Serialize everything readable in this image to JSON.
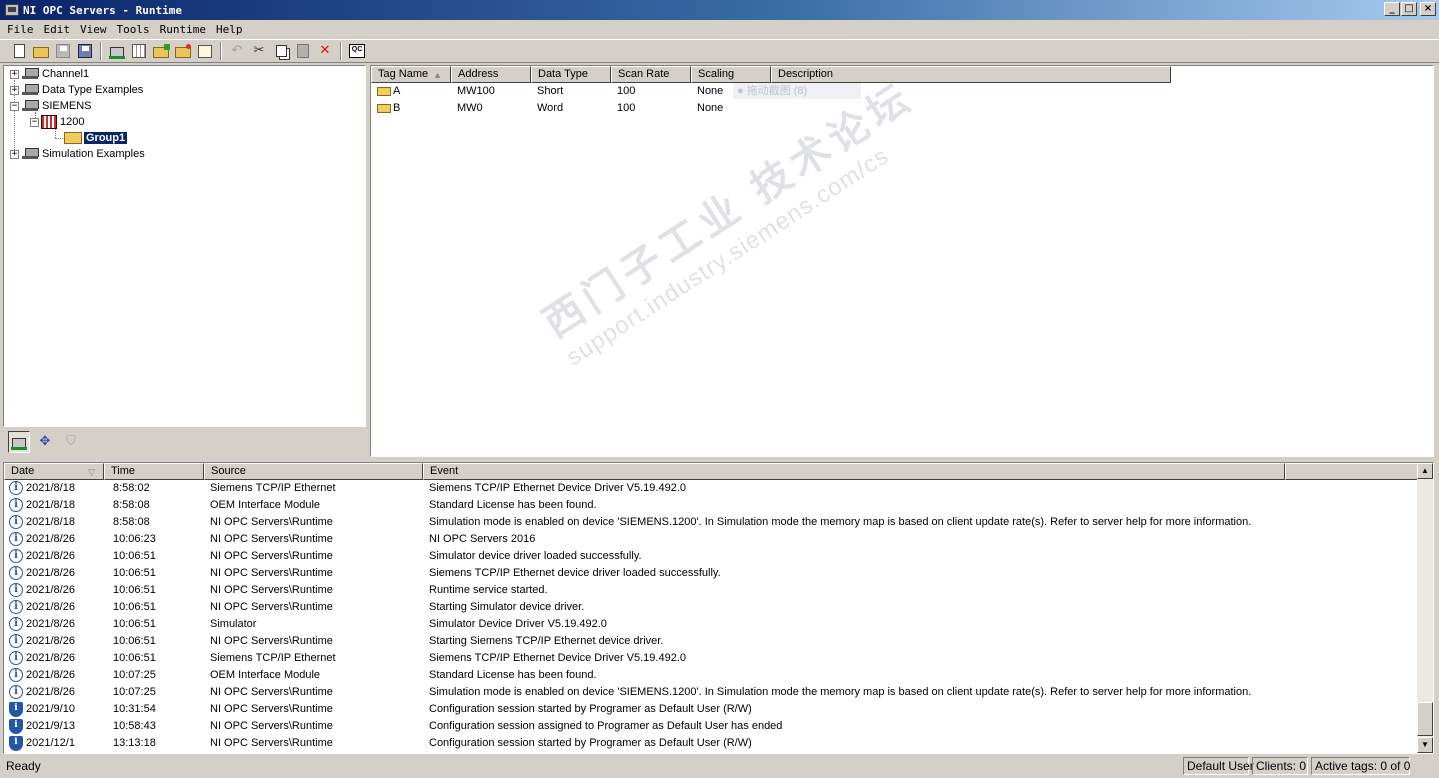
{
  "window": {
    "title": "NI OPC Servers - Runtime"
  },
  "menu": [
    "File",
    "Edit",
    "View",
    "Tools",
    "Runtime",
    "Help"
  ],
  "toolbar": {
    "buttons": [
      {
        "name": "new-project-icon"
      },
      {
        "name": "open-folder-icon"
      },
      {
        "name": "save-icon"
      },
      {
        "name": "save-as-icon"
      },
      {
        "name": "new-channel-icon"
      },
      {
        "name": "new-device-icon"
      },
      {
        "name": "new-group-icon"
      },
      {
        "name": "new-tag-icon"
      },
      {
        "name": "properties-icon"
      },
      {
        "name": "undo-icon"
      },
      {
        "name": "cut-icon"
      },
      {
        "name": "copy-icon"
      },
      {
        "name": "paste-icon"
      },
      {
        "name": "delete-icon"
      },
      {
        "name": "quick-client-icon"
      }
    ],
    "qc_label": "QC"
  },
  "tree": {
    "items": [
      {
        "label": "Channel1",
        "expander": "+"
      },
      {
        "label": "Data Type Examples",
        "expander": "+"
      },
      {
        "label": "SIEMENS",
        "expander": "−"
      },
      {
        "label": "1200",
        "expander": "−"
      },
      {
        "label": "Group1",
        "selected": true
      },
      {
        "label": "Simulation Examples",
        "expander": "+"
      }
    ]
  },
  "tags": {
    "columns": [
      "Tag Name",
      "Address",
      "Data Type",
      "Scan Rate",
      "Scaling",
      "Description"
    ],
    "rows": [
      {
        "name": "A",
        "address": "MW100",
        "type": "Short",
        "rate": "100",
        "scaling": "None",
        "description": ""
      },
      {
        "name": "B",
        "address": "MW0",
        "type": "Word",
        "rate": "100",
        "scaling": "None",
        "description": ""
      }
    ],
    "overlay_text": "● 拖动截图 (8)"
  },
  "log": {
    "columns": [
      "Date",
      "Time",
      "Source",
      "Event"
    ],
    "rows": [
      {
        "icon": "info",
        "date": "2021/8/18",
        "time": "8:58:02",
        "source": "Siemens TCP/IP Ethernet",
        "event": "Siemens TCP/IP Ethernet Device Driver V5.19.492.0"
      },
      {
        "icon": "info",
        "date": "2021/8/18",
        "time": "8:58:08",
        "source": "OEM Interface Module",
        "event": "Standard License has been found."
      },
      {
        "icon": "info",
        "date": "2021/8/18",
        "time": "8:58:08",
        "source": "NI OPC Servers\\Runtime",
        "event": "Simulation mode is enabled on device 'SIEMENS.1200'. In Simulation mode the memory map is based on client update rate(s). Refer to server help for more information."
      },
      {
        "icon": "info",
        "date": "2021/8/26",
        "time": "10:06:23",
        "source": "NI OPC Servers\\Runtime",
        "event": "NI OPC Servers 2016"
      },
      {
        "icon": "info",
        "date": "2021/8/26",
        "time": "10:06:51",
        "source": "NI OPC Servers\\Runtime",
        "event": "Simulator device driver loaded successfully."
      },
      {
        "icon": "info",
        "date": "2021/8/26",
        "time": "10:06:51",
        "source": "NI OPC Servers\\Runtime",
        "event": "Siemens TCP/IP Ethernet device driver loaded successfully."
      },
      {
        "icon": "info",
        "date": "2021/8/26",
        "time": "10:06:51",
        "source": "NI OPC Servers\\Runtime",
        "event": "Runtime service started."
      },
      {
        "icon": "info",
        "date": "2021/8/26",
        "time": "10:06:51",
        "source": "NI OPC Servers\\Runtime",
        "event": "Starting Simulator device driver."
      },
      {
        "icon": "info",
        "date": "2021/8/26",
        "time": "10:06:51",
        "source": "Simulator",
        "event": "Simulator Device Driver V5.19.492.0"
      },
      {
        "icon": "info",
        "date": "2021/8/26",
        "time": "10:06:51",
        "source": "NI OPC Servers\\Runtime",
        "event": "Starting Siemens TCP/IP Ethernet device driver."
      },
      {
        "icon": "info",
        "date": "2021/8/26",
        "time": "10:06:51",
        "source": "Siemens TCP/IP Ethernet",
        "event": "Siemens TCP/IP Ethernet Device Driver V5.19.492.0"
      },
      {
        "icon": "info",
        "date": "2021/8/26",
        "time": "10:07:25",
        "source": "OEM Interface Module",
        "event": "Standard License has been found."
      },
      {
        "icon": "info",
        "date": "2021/8/26",
        "time": "10:07:25",
        "source": "NI OPC Servers\\Runtime",
        "event": "Simulation mode is enabled on device 'SIEMENS.1200'. In Simulation mode the memory map is based on client update rate(s). Refer to server help for more information."
      },
      {
        "icon": "security",
        "date": "2021/9/10",
        "time": "10:31:54",
        "source": "NI OPC Servers\\Runtime",
        "event": "Configuration session started by Programer as Default User (R/W)"
      },
      {
        "icon": "security",
        "date": "2021/9/13",
        "time": "10:58:43",
        "source": "NI OPC Servers\\Runtime",
        "event": "Configuration session assigned to Programer as Default User has ended"
      },
      {
        "icon": "security",
        "date": "2021/12/1",
        "time": "13:13:18",
        "source": "NI OPC Servers\\Runtime",
        "event": "Configuration session started by Programer as Default User (R/W)"
      }
    ]
  },
  "status": {
    "text": "Ready",
    "user": "Default User",
    "clients": "Clients:  0",
    "active_tags": "Active tags:  0 of 0"
  },
  "watermark": {
    "line1": "西门子工业 技术论坛",
    "line2": "support.industry.siemens.com/cs"
  }
}
